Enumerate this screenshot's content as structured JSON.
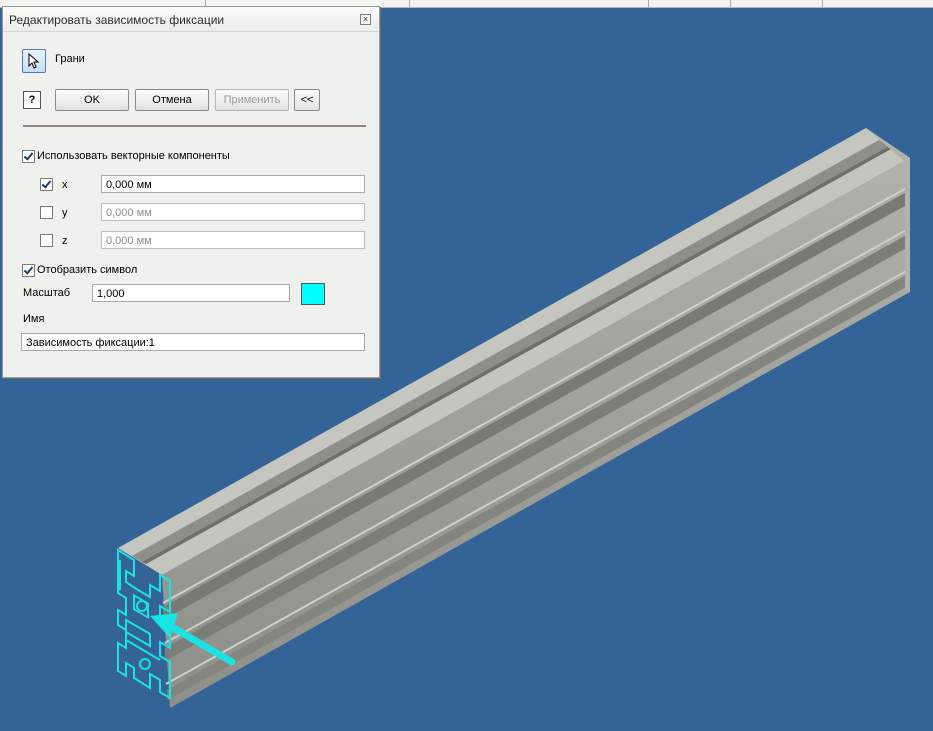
{
  "dialog": {
    "title": "Редактировать зависимость фиксации",
    "select_label": "Грани",
    "ok_label": "OK",
    "cancel_label": "Отмена",
    "apply_label": "Применить",
    "collapse_label": "<<",
    "help_symbol": "?",
    "close_symbol": "×",
    "use_vector": {
      "label": "Использовать векторные компоненты",
      "checked": true
    },
    "components": [
      {
        "axis": "x",
        "value": "0,000 мм",
        "checked": true
      },
      {
        "axis": "y",
        "value": "0,000 мм",
        "checked": false
      },
      {
        "axis": "z",
        "value": "0,000 мм",
        "checked": false
      }
    ],
    "show_symbol": {
      "label": "Отобразить символ",
      "checked": true
    },
    "scale_label": "Масштаб",
    "scale_value": "1,000",
    "symbol_color": "#00ffff",
    "name_label": "Имя",
    "name_value": "Зависимость фиксации:1"
  },
  "viewport": {
    "background": "#346497",
    "highlight_color": "#19e3e3",
    "profile_color": "#a6a6a0"
  }
}
